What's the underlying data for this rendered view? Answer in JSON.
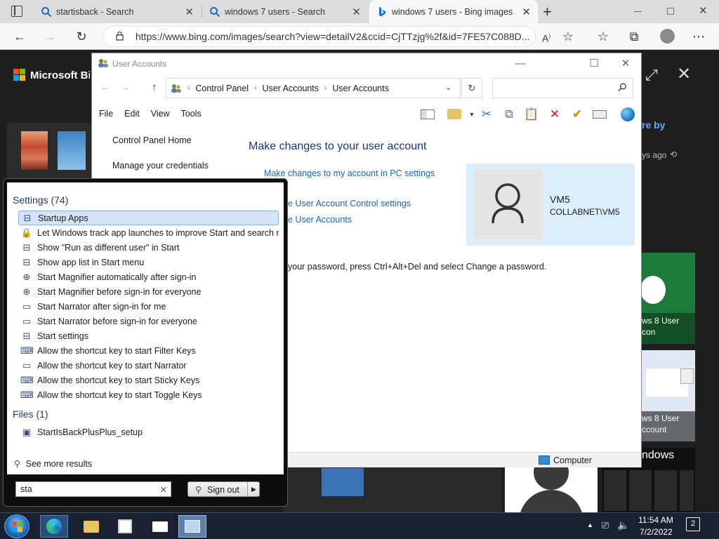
{
  "browser": {
    "tabs": [
      {
        "label": "startisback - Search",
        "icon": "search-icon"
      },
      {
        "label": "windows 7 users - Search",
        "icon": "search-icon"
      },
      {
        "label": "windows 7 users - Bing images",
        "icon": "bing-logo-icon"
      }
    ],
    "url": "https://www.bing.com/images/search?view=detailV2&ccid=CjTTzjg%2f&id=7FE57C088D...",
    "new_tab": "+"
  },
  "bing": {
    "logo_text": "Microsoft Bing",
    "share_fragment": "re by",
    "time_fragment": "ys ago",
    "tile1_line1": "ws 8 User",
    "tile1_line2": "con",
    "tile2_line1": "ws 8 User",
    "tile2_line2": "ccount",
    "tile3_text": "ndows"
  },
  "user_accounts": {
    "title": "User Accounts",
    "breadcrumb": [
      "Control Panel",
      "User Accounts",
      "User Accounts"
    ],
    "menu": [
      "File",
      "Edit",
      "View",
      "Tools"
    ],
    "left_nav": [
      "Control Panel Home",
      "Manage your credentials"
    ],
    "heading": "Make changes to your user account",
    "links": [
      "Make changes to my account in PC settings",
      "e User Account Control settings",
      "e User Accounts"
    ],
    "password_hint": "your password, press Ctrl+Alt+Del and select Change a password.",
    "account_name": "VM5",
    "account_domain": "COLLABNET\\VM5",
    "status_text": "Computer",
    "help_glyph": "?"
  },
  "start_menu": {
    "settings_header": "Settings (74)",
    "settings_items": [
      {
        "label": "Startup Apps",
        "icon": "startup-apps-icon",
        "selected": true
      },
      {
        "label": "Let Windows track app launches to improve Start and search re...",
        "icon": "lock-icon"
      },
      {
        "label": "Show \"Run as different user\" in Start",
        "icon": "start-menu-icon"
      },
      {
        "label": "Show app list in Start menu",
        "icon": "start-menu-icon"
      },
      {
        "label": "Start Magnifier automatically after sign-in",
        "icon": "magnifier-icon"
      },
      {
        "label": "Start Magnifier before sign-in for everyone",
        "icon": "magnifier-icon"
      },
      {
        "label": "Start Narrator after sign-in for me",
        "icon": "narrator-icon"
      },
      {
        "label": "Start Narrator before sign-in for everyone",
        "icon": "narrator-icon"
      },
      {
        "label": "Start settings",
        "icon": "start-menu-icon"
      },
      {
        "label": "Allow the shortcut key to start Filter Keys",
        "icon": "keyboard-icon"
      },
      {
        "label": "Allow the shortcut key to start Narrator",
        "icon": "narrator-icon"
      },
      {
        "label": "Allow the shortcut key to start Sticky Keys",
        "icon": "keyboard-icon"
      },
      {
        "label": "Allow the shortcut key to start Toggle Keys",
        "icon": "keyboard-icon"
      }
    ],
    "files_header": "Files (1)",
    "files_items": [
      {
        "label": "StartIsBackPlusPlus_setup",
        "icon": "setup-file-icon"
      }
    ],
    "see_more": "See more results",
    "search_value": "sta",
    "signout_label": "Sign out"
  },
  "taskbar": {
    "time": "11:54 AM",
    "date": "7/2/2022",
    "notifications": "2"
  }
}
